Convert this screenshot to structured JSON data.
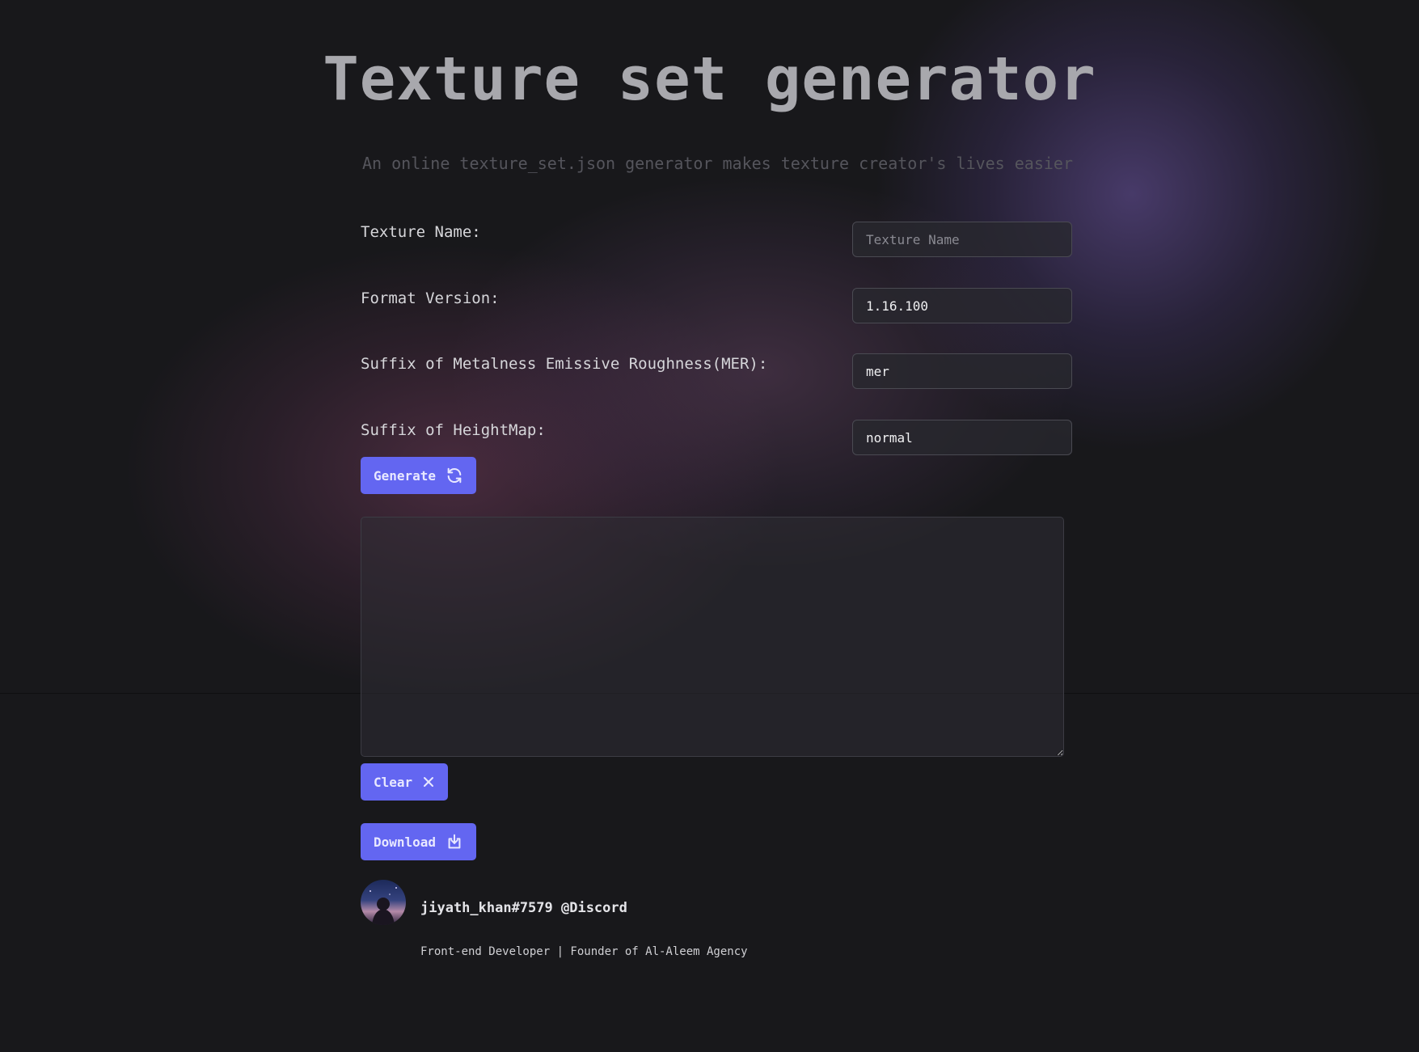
{
  "header": {
    "title": "Texture set generator",
    "subtitle": "An online texture_set.json generator makes texture creator's lives easier"
  },
  "form": {
    "texture_name": {
      "label": "Texture Name:",
      "value": "",
      "placeholder": "Texture Name"
    },
    "format_version": {
      "label": "Format Version:",
      "value": "1.16.100"
    },
    "mer_suffix": {
      "label": "Suffix of Metalness Emissive Roughness(MER):",
      "value": "mer"
    },
    "heightmap_suffix": {
      "label": "Suffix of HeightMap:",
      "value": "normal"
    }
  },
  "actions": {
    "generate_label": "Generate",
    "generate_icon": "refresh-icon",
    "clear_label": "Clear",
    "clear_icon": "close-icon",
    "download_label": "Download",
    "download_icon": "download-icon"
  },
  "output": {
    "value": ""
  },
  "author": {
    "handle": "jiyath_khan#7579 @Discord",
    "role": "Front-end Developer | Founder of Al-Aleem Agency"
  },
  "colors": {
    "background": "#18181b",
    "accent": "#6366f1",
    "title": "#a8a8ad",
    "subtitle": "#55555c"
  }
}
